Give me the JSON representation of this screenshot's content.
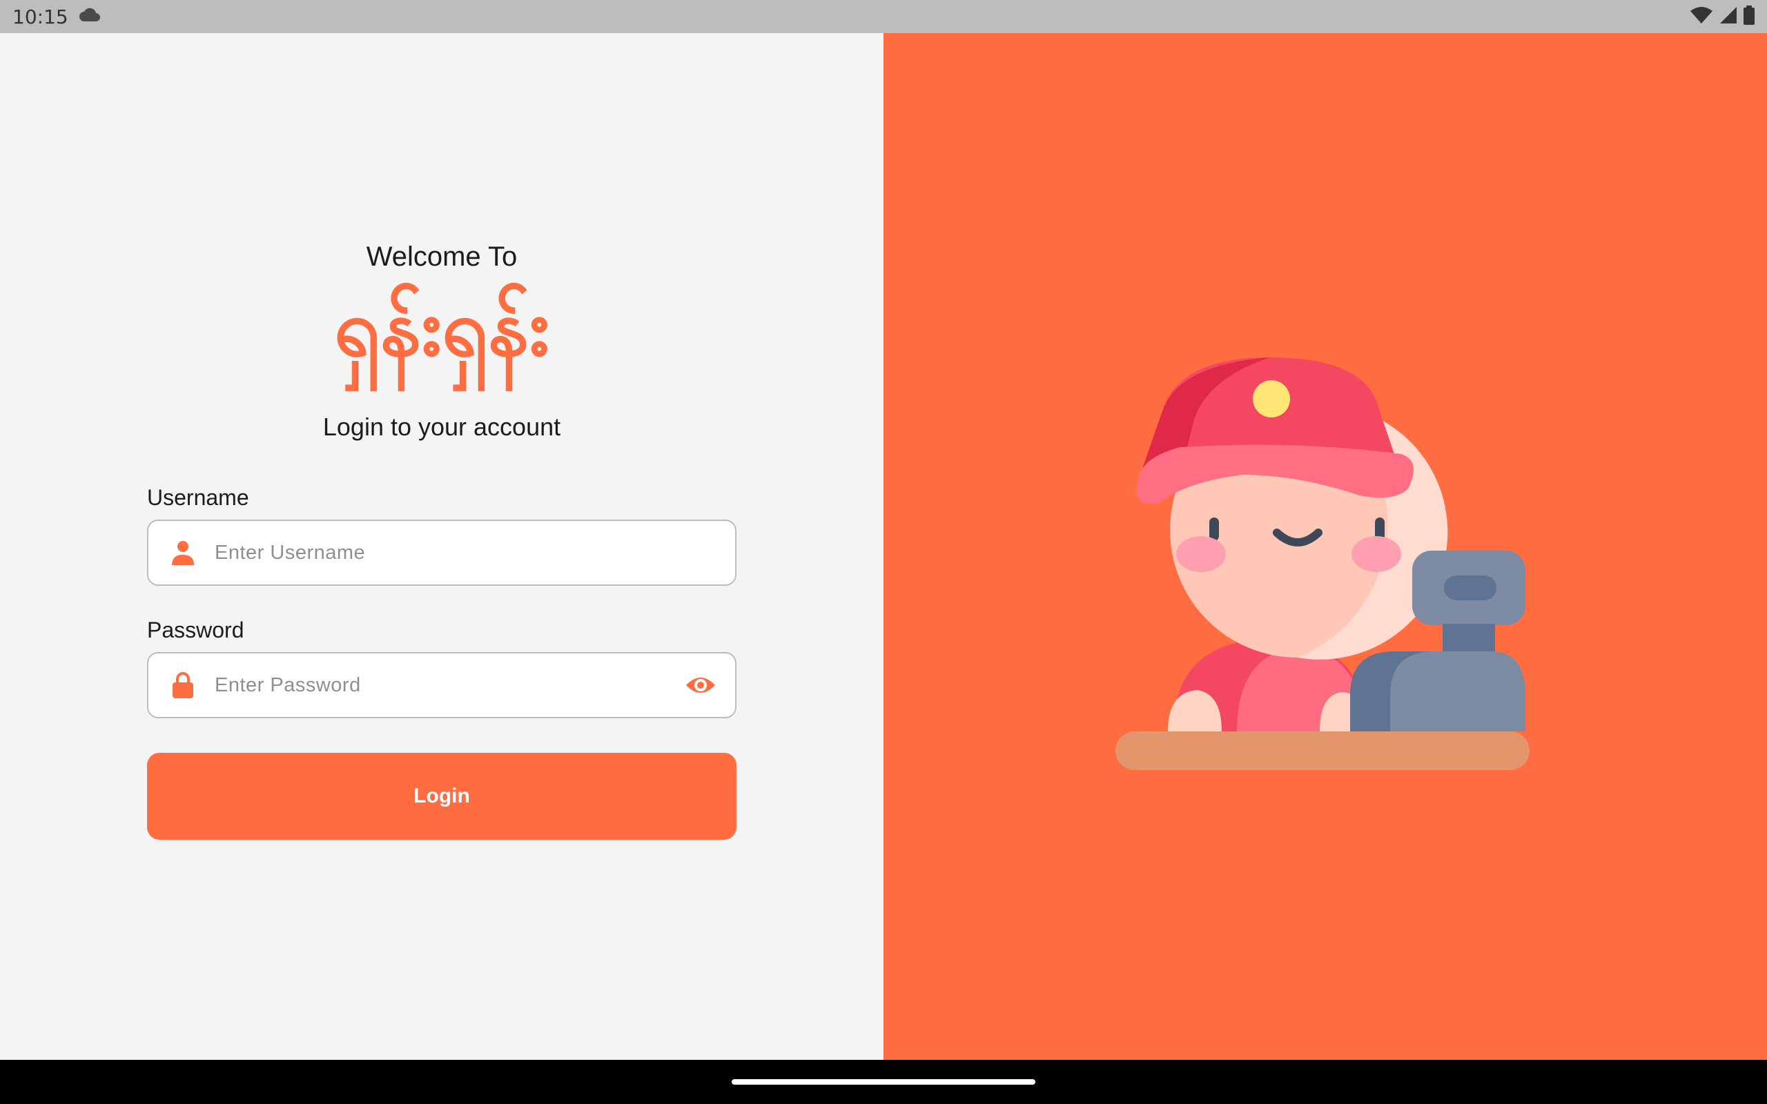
{
  "status_bar": {
    "time": "10:15",
    "icons": [
      "cloud-icon",
      "wifi-icon",
      "signal-icon",
      "battery-icon"
    ]
  },
  "login": {
    "welcome": "Welcome To",
    "app_name": "ရှန်းရှန်း",
    "subtitle": "Login to your account",
    "username": {
      "label": "Username",
      "placeholder": "Enter Username",
      "value": "",
      "icon": "person-icon"
    },
    "password": {
      "label": "Password",
      "placeholder": "Enter Password",
      "value": "",
      "icon": "lock-icon",
      "toggle_icon": "eye-icon"
    },
    "button_label": "Login"
  },
  "colors": {
    "accent": "#ff6d40",
    "background": "#f4f4f4",
    "status_bar": "#bdbdbd"
  },
  "illustration": {
    "subject": "cashier-character-icon"
  }
}
